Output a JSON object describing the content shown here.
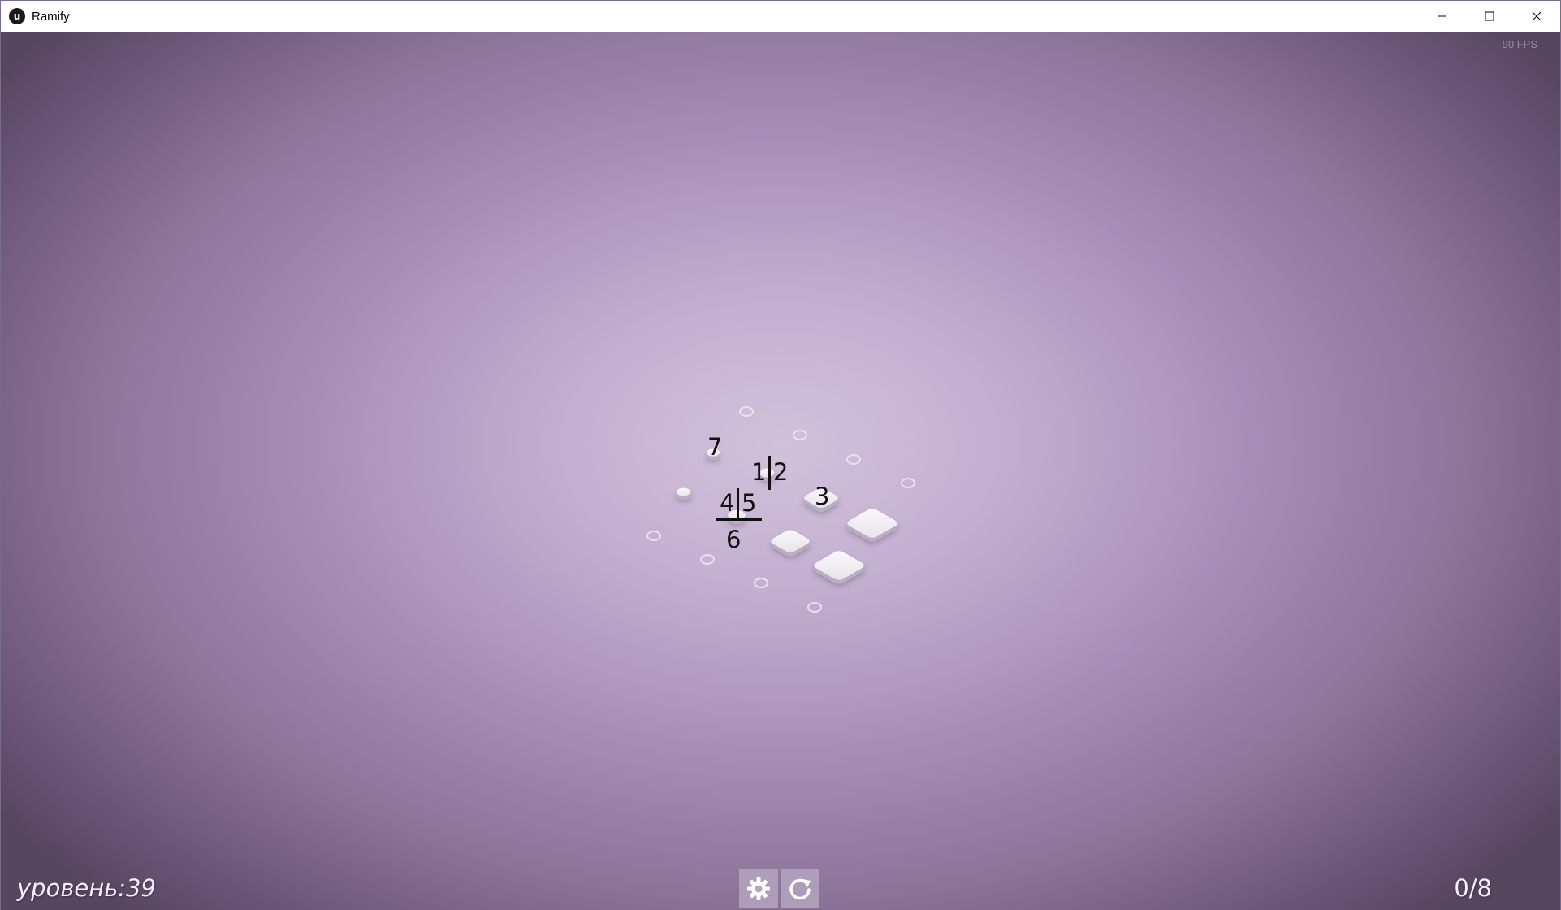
{
  "window": {
    "title": "Ramify",
    "app_icon_glyph": "u",
    "controls": [
      "minimize-icon",
      "maximize-icon",
      "close-icon"
    ]
  },
  "hud": {
    "fps": "90 FPS",
    "level": "уровень:39",
    "progress": "0/8"
  },
  "toolbar": {
    "buttons": [
      "gear-icon",
      "restart-icon"
    ]
  },
  "board": {
    "labels": {
      "n1": "1",
      "n2": "2",
      "n3": "3",
      "n4": "4",
      "n5": "5",
      "n6": "6",
      "n7": "7"
    }
  },
  "colors": {
    "background_center": "#d1c2da",
    "background_edge": "#57465f",
    "tile": "#f0edf3",
    "hud_text": "#f4eef7"
  }
}
